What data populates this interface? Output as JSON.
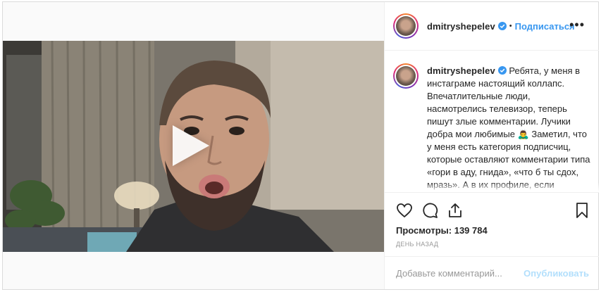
{
  "post": {
    "username": "dmitryshepelev",
    "follow_label": "Подписаться",
    "separator": "•",
    "more_label": "•••"
  },
  "caption": {
    "username": "dmitryshepelev",
    "text": "Ребята, у меня в инстаграме настоящий коллапс. Впечатлительные люди, насмотрелись телевизор, теперь пишут злые комментарии. Лучики добра мои любимые 🙇‍♂️ Заметил, что у меня есть категория подписчиц, которые оставляют комментарии типа «гори в аду, гнида», «что б ты сдох, мразь». А в их профиле, если заглянуть, обычные фото..."
  },
  "stats": {
    "views_label": "Просмотры:",
    "views_value": "139 784",
    "time": "ДЕНЬ НАЗАД"
  },
  "comment": {
    "placeholder": "Добавьте комментарий...",
    "publish_label": "Опубликовать"
  },
  "icons": {
    "like": "heart-icon",
    "comment": "comment-icon",
    "share": "share-icon",
    "save": "bookmark-icon",
    "play": "play-icon",
    "verified": "verified-badge-icon"
  },
  "colors": {
    "accent": "#3897f0",
    "publish_disabled": "#b2dffc",
    "border": "#dbdbdb",
    "muted": "#999999"
  }
}
